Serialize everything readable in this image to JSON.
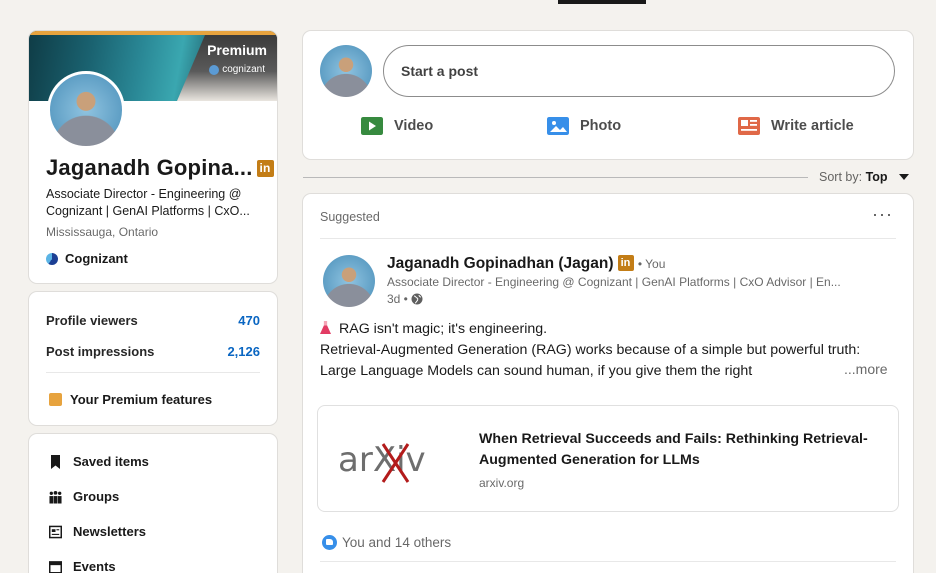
{
  "colors": {
    "brand_blue": "#0a66c2",
    "premium_gold": "#e7a33e",
    "linkedin_badge": "#c37d16",
    "video_green": "#378a3f",
    "photo_blue": "#378fe9",
    "article_orange": "#e06847"
  },
  "profile": {
    "premium_label": "Premium",
    "banner_company": "cognizant",
    "name": "Jaganadh Gopina...",
    "badge_icon": "linkedin-premium-icon",
    "headline": "Associate Director - Engineering @ Cognizant | GenAI Platforms | CxO...",
    "location": "Mississauga, Ontario",
    "company": "Cognizant"
  },
  "stats": {
    "profile_viewers_label": "Profile viewers",
    "profile_viewers_value": "470",
    "post_impressions_label": "Post impressions",
    "post_impressions_value": "2,126",
    "premium_features_label": "Your Premium features"
  },
  "links": {
    "saved_items": "Saved items",
    "groups": "Groups",
    "newsletters": "Newsletters",
    "events": "Events"
  },
  "composer": {
    "start_post": "Start a post",
    "video": "Video",
    "photo": "Photo",
    "write_article": "Write article"
  },
  "sort": {
    "label": "Sort by:",
    "value": "Top"
  },
  "post": {
    "suggested": "Suggested",
    "more_options": "···",
    "author_name": "Jaganadh Gopinadhan (Jagan)",
    "you": "• You",
    "author_headline": "Associate Director - Engineering @ Cognizant | GenAI Platforms | CxO Advisor | En...",
    "time": "3d •",
    "line1": "RAG isn't magic; it's engineering.",
    "line2": "Retrieval-Augmented Generation (RAG) works because of a simple but powerful truth: Large Language Models can sound human, if you give them the right",
    "more": "...more",
    "link_title": "When Retrieval Succeeds and Fails: Rethinking Retrieval-Augmented Generation for LLMs",
    "link_domain": "arxiv.org",
    "link_logo_text": "arXiv",
    "reactions": "You and 14 others"
  }
}
